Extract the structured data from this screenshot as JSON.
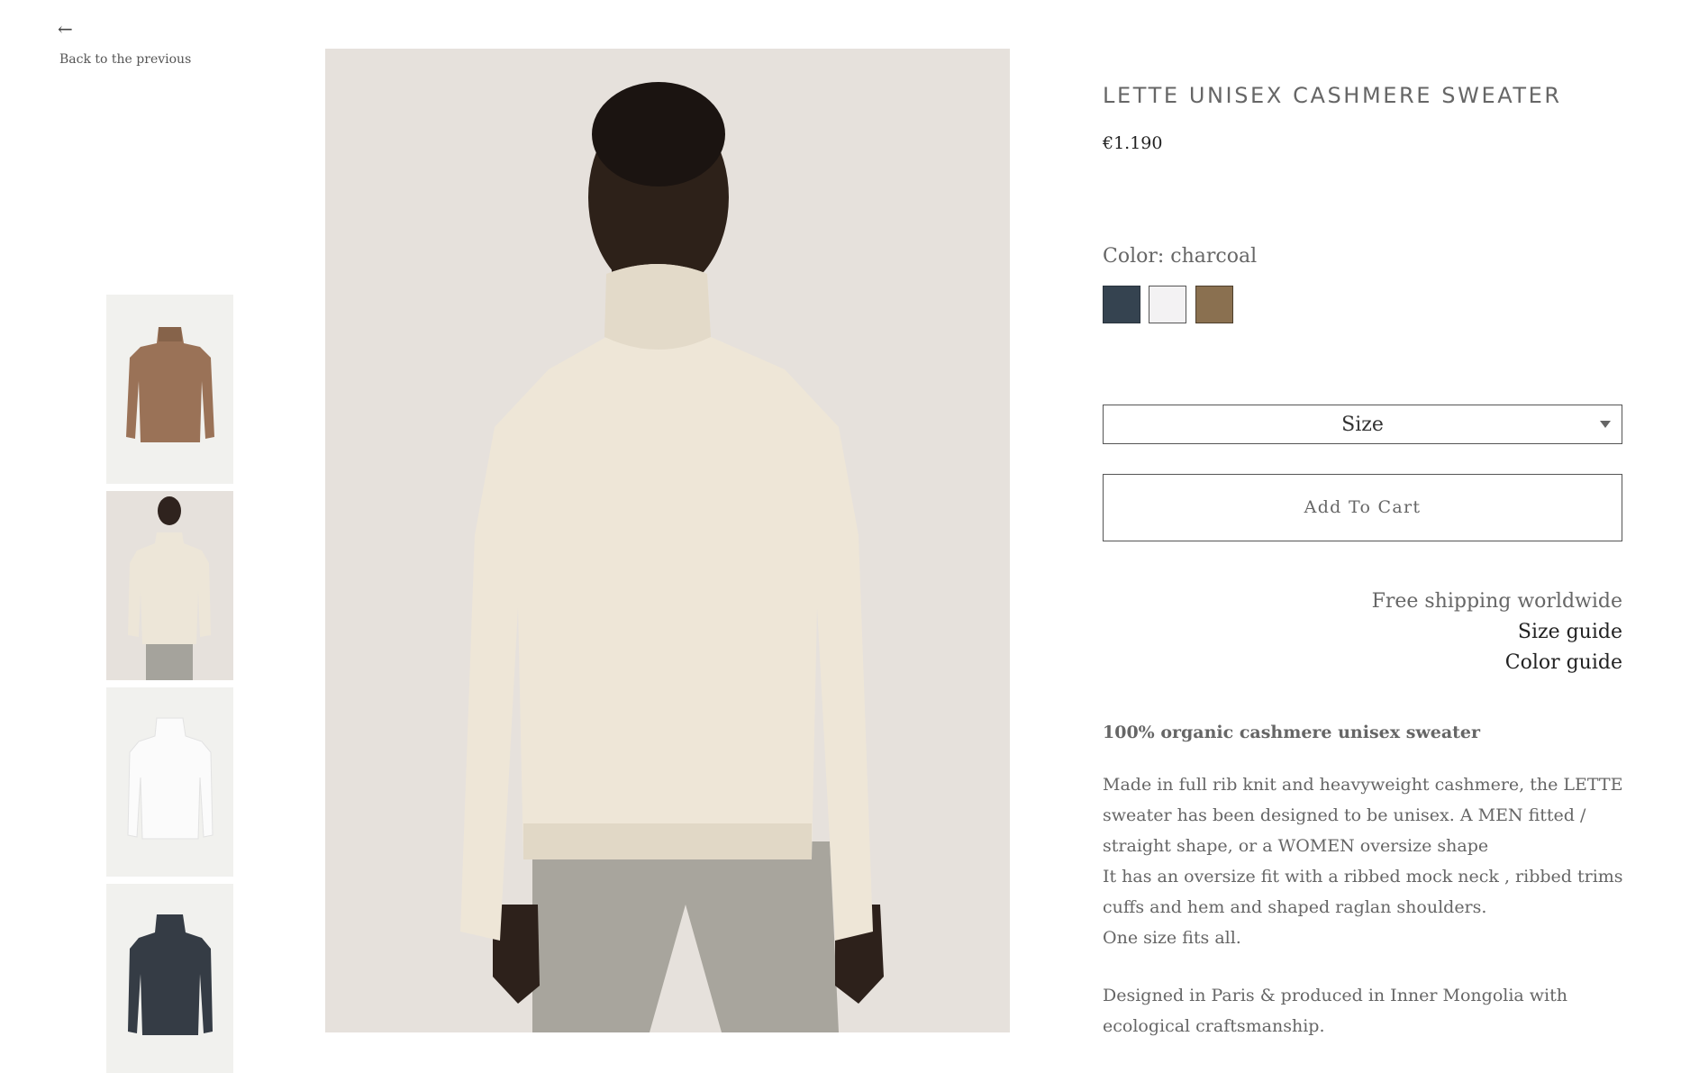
{
  "nav": {
    "back_icon": "arrow-left-icon",
    "back_label": "Back to the previous"
  },
  "gallery": {
    "thumbnails": [
      {
        "name": "camel-sweater-thumbnail",
        "color": "#9a7257"
      },
      {
        "name": "model-cream-sweater-thumbnail",
        "color": "#ede6d8"
      },
      {
        "name": "white-sweater-thumbnail",
        "color": "#ececec"
      },
      {
        "name": "charcoal-sweater-thumbnail",
        "color": "#353c45"
      }
    ],
    "selected_index": 1
  },
  "product": {
    "title": "LETTE UNISEX CASHMERE SWEATER",
    "price": "€1.190",
    "color_label": "Color: charcoal",
    "swatches": [
      {
        "name": "charcoal",
        "hex": "#354350"
      },
      {
        "name": "white",
        "hex": "#f3f2f3"
      },
      {
        "name": "camel",
        "hex": "#8a7050"
      }
    ],
    "size_select": {
      "label": "Size",
      "icon": "caret-down-icon"
    },
    "add_to_cart_label": "Add To Cart",
    "info": {
      "shipping": "Free shipping worldwide",
      "size_guide": "Size guide",
      "color_guide": "Color guide"
    },
    "description": {
      "headline": "100% organic cashmere unisex sweater",
      "lines": [
        "Made in full rib knit and heavyweight cashmere, the LETTE sweater has been designed to be unisex. A MEN  fitted / straight shape, or a WOMEN oversize shape",
        "It has an oversize fit with a ribbed mock neck , ribbed  trims cuffs and hem  and shaped raglan shoulders.",
        "One size fits all."
      ],
      "origin": "Designed in Paris & produced in Inner Mongolia with ecological craftsmanship."
    }
  }
}
